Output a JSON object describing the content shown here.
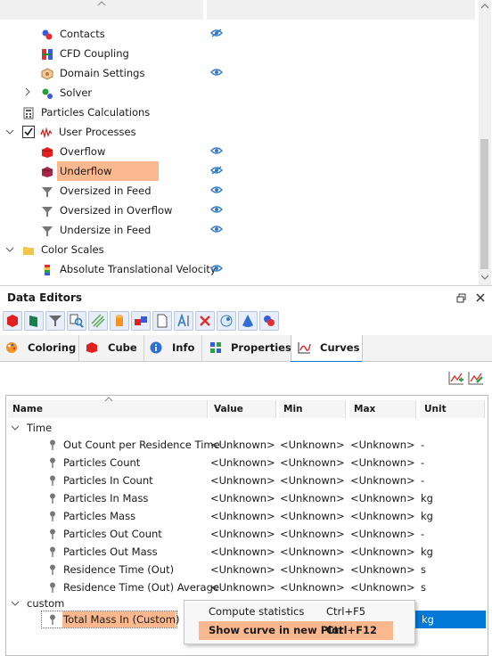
{
  "tree": {
    "items": [
      {
        "label": "Contacts",
        "icon": "contacts-icon",
        "eye": "hidden"
      },
      {
        "label": "CFD Coupling",
        "icon": "cfd-coupling-icon",
        "eye": "none"
      },
      {
        "label": "Domain Settings",
        "icon": "domain-settings-icon",
        "eye": "visible"
      },
      {
        "label": "Solver",
        "icon": "solver-icon",
        "eye": "none"
      },
      {
        "label": "Particles Calculations",
        "icon": "calculator-icon",
        "eye": "none"
      },
      {
        "label": "User Processes",
        "icon": "user-processes-icon",
        "eye": "none"
      },
      {
        "label": "Overflow",
        "icon": "red-cube-icon",
        "eye": "visible"
      },
      {
        "label": "Underflow",
        "icon": "maroon-cube-icon",
        "eye": "hidden"
      },
      {
        "label": "Oversized in Feed",
        "icon": "funnel-icon",
        "eye": "visible"
      },
      {
        "label": "Oversized in Overflow",
        "icon": "funnel-icon",
        "eye": "visible"
      },
      {
        "label": "Undersize in Feed",
        "icon": "funnel-icon",
        "eye": "visible"
      },
      {
        "label": "Color Scales",
        "icon": "none",
        "eye": "none"
      },
      {
        "label": "Absolute Translational Velocity",
        "icon": "color-scale-icon",
        "eye": "visible"
      }
    ]
  },
  "data_editors": {
    "title": "Data Editors",
    "tabs": [
      {
        "label": "Coloring",
        "icon": "palette-icon"
      },
      {
        "label": "Cube",
        "icon": "cube-icon"
      },
      {
        "label": "Info",
        "icon": "info-icon"
      },
      {
        "label": "Properties",
        "icon": "properties-icon"
      },
      {
        "label": "Curves",
        "icon": "curves-icon"
      }
    ],
    "active_tab": "Curves"
  },
  "grid": {
    "columns": [
      "Name",
      "Value",
      "Min",
      "Max",
      "Unit"
    ],
    "groups": [
      {
        "label": "Time",
        "rows": [
          {
            "name": "Out Count per Residence Time",
            "value": "<Unknown>",
            "min": "<Unknown>",
            "max": "<Unknown>",
            "unit": "-"
          },
          {
            "name": "Particles Count",
            "value": "<Unknown>",
            "min": "<Unknown>",
            "max": "<Unknown>",
            "unit": "-"
          },
          {
            "name": "Particles In Count",
            "value": "<Unknown>",
            "min": "<Unknown>",
            "max": "<Unknown>",
            "unit": "-"
          },
          {
            "name": "Particles In Mass",
            "value": "<Unknown>",
            "min": "<Unknown>",
            "max": "<Unknown>",
            "unit": "kg"
          },
          {
            "name": "Particles Mass",
            "value": "<Unknown>",
            "min": "<Unknown>",
            "max": "<Unknown>",
            "unit": "kg"
          },
          {
            "name": "Particles Out Count",
            "value": "<Unknown>",
            "min": "<Unknown>",
            "max": "<Unknown>",
            "unit": "-"
          },
          {
            "name": "Particles Out Mass",
            "value": "<Unknown>",
            "min": "<Unknown>",
            "max": "<Unknown>",
            "unit": "kg"
          },
          {
            "name": "Residence Time (Out)",
            "value": "<Unknown>",
            "min": "<Unknown>",
            "max": "<Unknown>",
            "unit": "s"
          },
          {
            "name": "Residence Time (Out) Average",
            "value": "<Unknown>",
            "min": "<Unknown>",
            "max": "<Unknown>",
            "unit": "s"
          }
        ]
      },
      {
        "label": "custom",
        "rows": [
          {
            "name": "Total Mass In (Custom)",
            "value": "",
            "min": "",
            "max": "",
            "unit": "kg"
          }
        ]
      }
    ]
  },
  "context_menu": {
    "items": [
      {
        "label": "Compute statistics",
        "shortcut": "Ctrl+F5"
      },
      {
        "label": "Show curve in new Plot",
        "shortcut": "Ctrl+F12"
      }
    ]
  },
  "colors": {
    "highlight": "#fbb88f",
    "accent": "#0078d7",
    "selected_row": "#0078d7"
  }
}
